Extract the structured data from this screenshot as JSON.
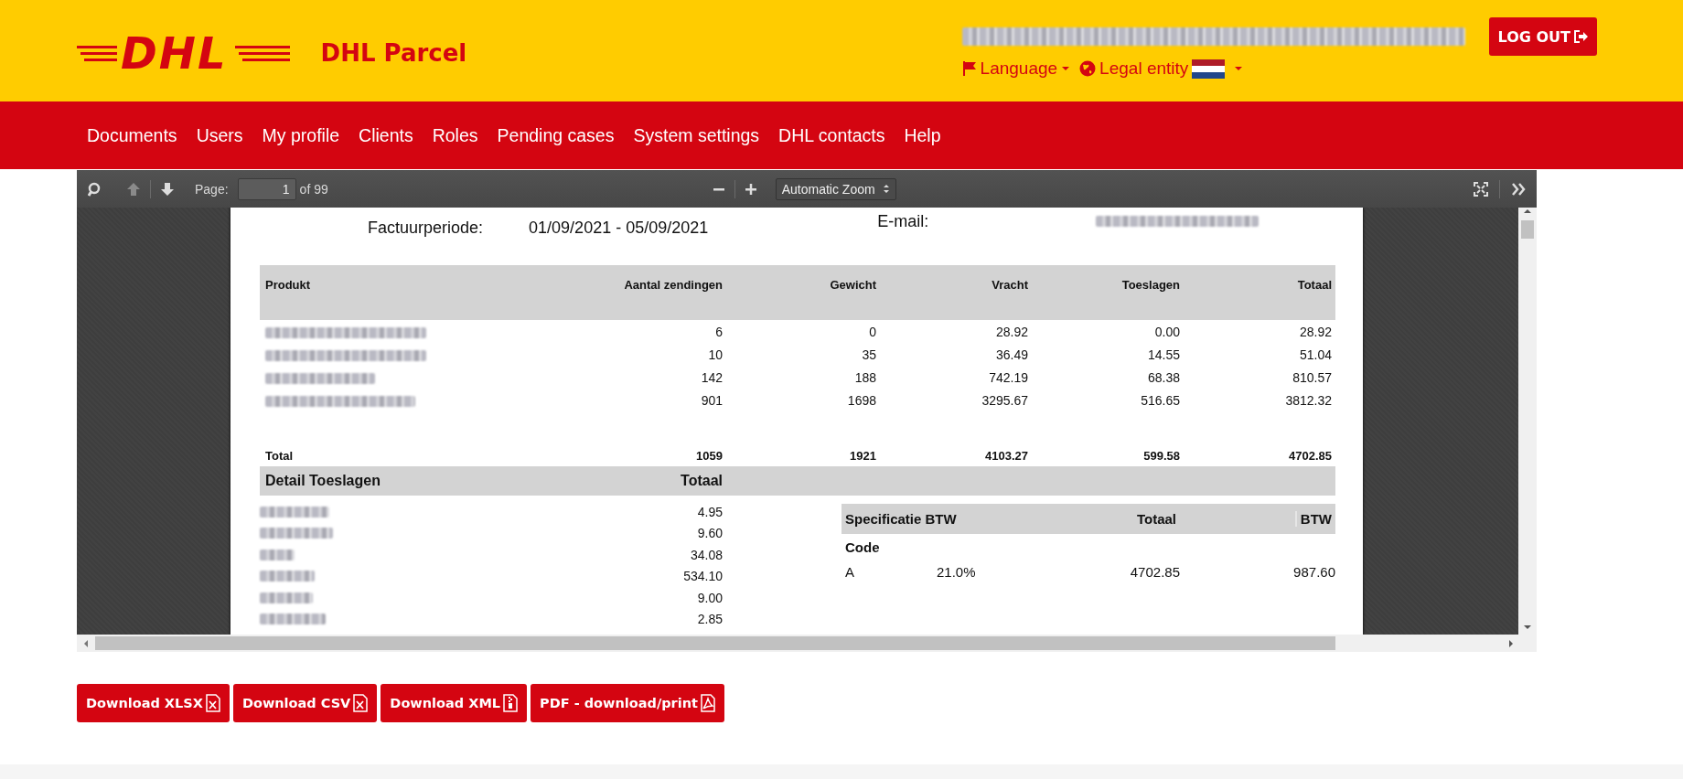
{
  "header": {
    "logo_text": "DHL",
    "brand": "DHL Parcel",
    "language_menu": "Language",
    "legal_entity_menu": "Legal entity",
    "logout": "LOG OUT"
  },
  "nav": [
    "Documents",
    "Users",
    "My profile",
    "Clients",
    "Roles",
    "Pending cases",
    "System settings",
    "DHL contacts",
    "Help"
  ],
  "viewer": {
    "toolbar": {
      "page_label": "Page:",
      "page_value": "1",
      "page_count": "of 99",
      "zoom": "Automatic Zoom",
      "previous_disabled": true
    },
    "document": {
      "period_label": "Factuurperiode:",
      "period_value": "01/09/2021 - 05/09/2021",
      "email_label": "E-mail:",
      "products": {
        "columns": [
          "Produkt",
          "Aantal zendingen",
          "Gewicht",
          "Vracht",
          "Toeslagen",
          "Totaal"
        ],
        "rows": [
          [
            "",
            "6",
            "0",
            "28.92",
            "0.00",
            "28.92"
          ],
          [
            "",
            "10",
            "35",
            "36.49",
            "14.55",
            "51.04"
          ],
          [
            "",
            "142",
            "188",
            "742.19",
            "68.38",
            "810.57"
          ],
          [
            "",
            "901",
            "1698",
            "3295.67",
            "516.65",
            "3812.32"
          ]
        ],
        "total": [
          "Total",
          "1059",
          "1921",
          "4103.27",
          "599.58",
          "4702.85"
        ]
      },
      "surcharges": {
        "title": "Detail Toeslagen",
        "total_heading": "Totaal",
        "values": [
          "4.95",
          "9.60",
          "34.08",
          "534.10",
          "9.00",
          "2.85"
        ]
      },
      "vat": {
        "columns": [
          "Specificatie BTW",
          "",
          "Totaal",
          "BTW"
        ],
        "code_label": "Code",
        "rows": [
          [
            "A",
            "21.0%",
            "4702.85",
            "987.60"
          ]
        ]
      }
    }
  },
  "buttons": [
    {
      "label": "Download XLSX",
      "kind": "spreadsheet"
    },
    {
      "label": "Download CSV",
      "kind": "spreadsheet"
    },
    {
      "label": "Download XML",
      "kind": "archive"
    },
    {
      "label": "PDF - download/print",
      "kind": "pdf"
    }
  ]
}
